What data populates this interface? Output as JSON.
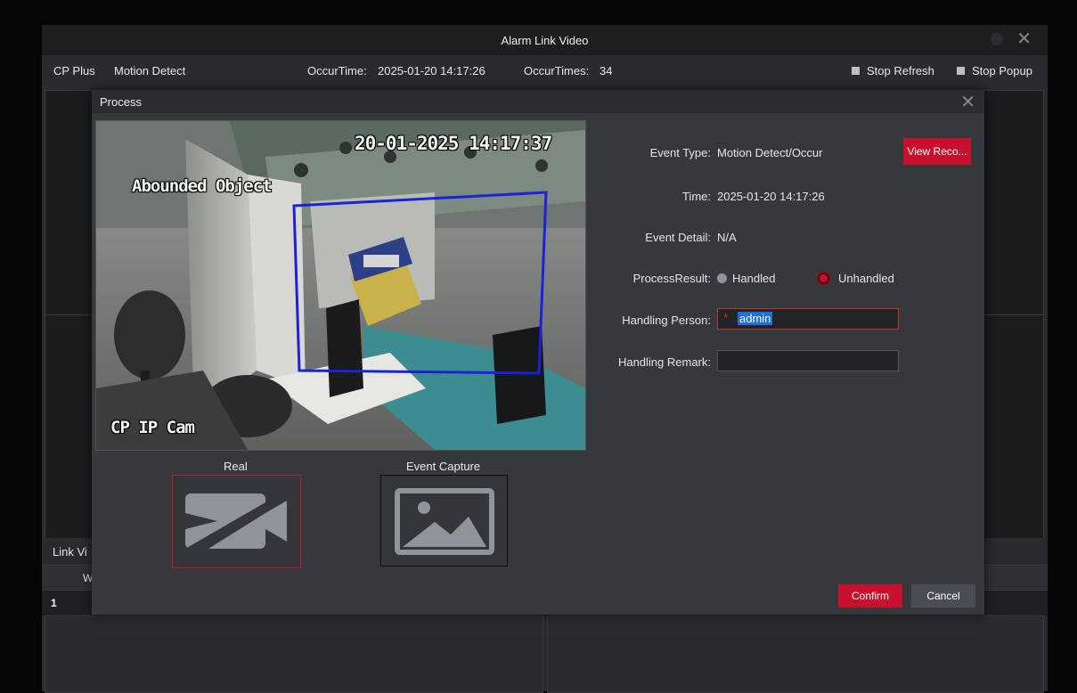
{
  "outer": {
    "title": "Alarm Link Video",
    "device": "CP Plus",
    "event": "Motion Detect",
    "occur_time_label": "OccurTime:",
    "occur_time": "2025-01-20 14:17:26",
    "occur_times_label": "OccurTimes:",
    "occur_times": "34",
    "stop_refresh": "Stop Refresh",
    "stop_popup": "Stop Popup",
    "link_label": "Link Vi",
    "table_head_col": "W",
    "table_row_index": "1"
  },
  "dialog": {
    "title": "Process",
    "video": {
      "timestamp": "20-01-2025 14:17:37",
      "overlay_label": "Abounded Object",
      "camera_name": "CP IP Cam"
    },
    "real_label": "Real",
    "capture_label": "Event Capture",
    "fields": {
      "event_type_label": "Event Type:",
      "event_type": "Motion Detect/Occur",
      "view_record": "View Reco...",
      "time_label": "Time:",
      "time": "2025-01-20 14:17:26",
      "event_detail_label": "Event Detail:",
      "event_detail": "N/A",
      "process_result_label": "ProcessResult:",
      "handled": "Handled",
      "unhandled": "Unhandled",
      "handling_person_label": "Handling Person:",
      "handling_person": "admin",
      "required_mark": "*",
      "handling_remark_label": "Handling Remark:"
    },
    "confirm": "Confirm",
    "cancel": "Cancel"
  },
  "colors": {
    "accent": "#c8102e",
    "roi_box": "#1c22d6"
  }
}
